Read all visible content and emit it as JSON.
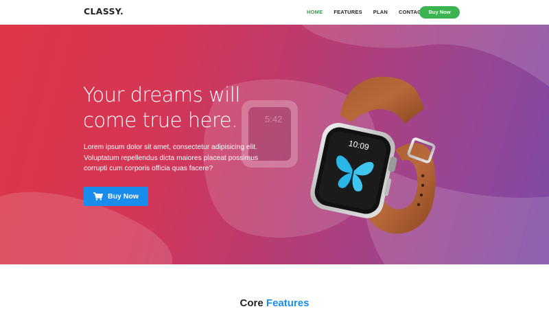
{
  "header": {
    "logo": "CLASSY.",
    "nav": [
      {
        "label": "HOME",
        "active": true
      },
      {
        "label": "FEATURES",
        "active": false
      },
      {
        "label": "PLAN",
        "active": false
      },
      {
        "label": "CONTACT",
        "active": false
      }
    ],
    "buy_label": "Buy Now"
  },
  "hero": {
    "title": "Your dreams will come true here.",
    "text": "Lorem ipsum dolor sit amet, consectetur adipisicing elit. Voluptatum repellendus dicta maiores placeat possimus corrupti cum corporis officia quas facere?",
    "button_label": "Buy Now",
    "button_icon": "cart-icon",
    "watch_time": "10:09",
    "bg_watch_time": "5:42"
  },
  "features": {
    "title_part1": "Core",
    "title_part2": "Features"
  },
  "colors": {
    "accent_green": "#3cb351",
    "accent_blue": "#1a8cec",
    "hero_gradient_start": "#dd3646",
    "hero_gradient_end": "#7c4aa5"
  }
}
